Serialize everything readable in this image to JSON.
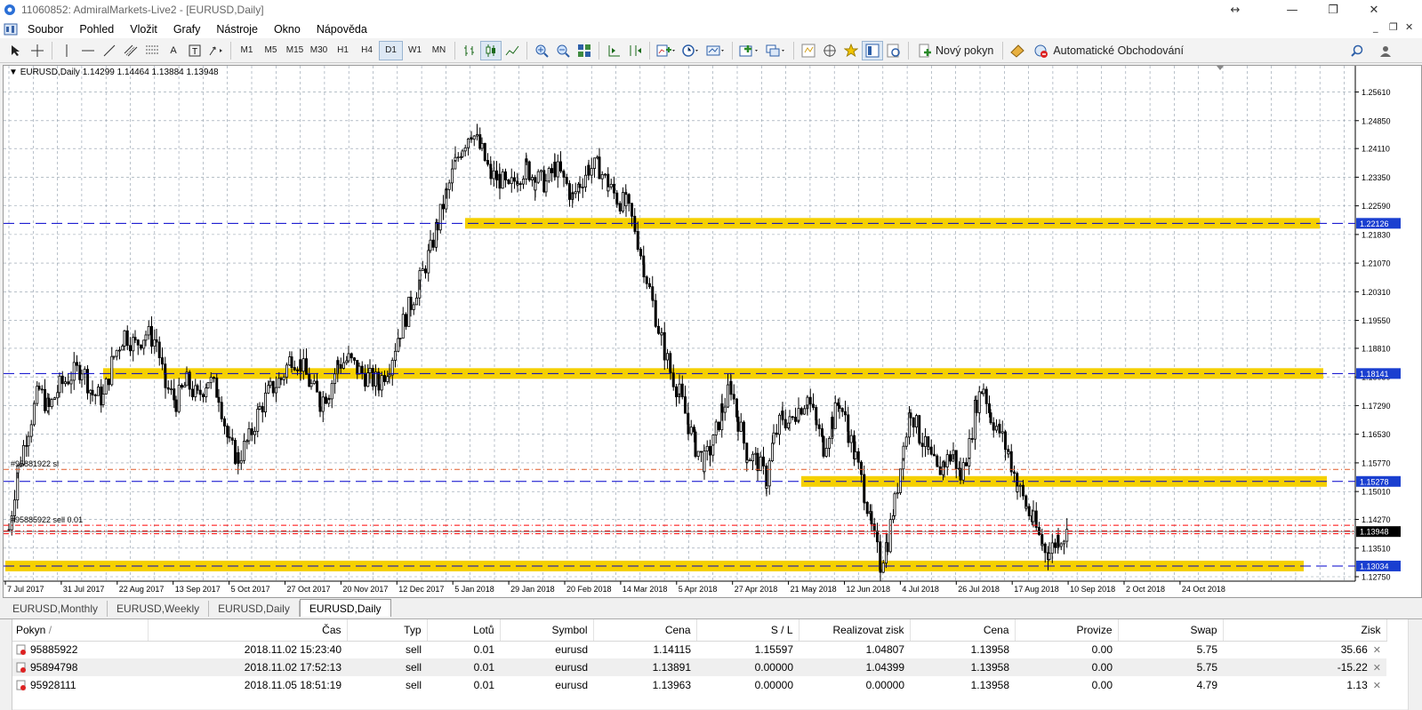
{
  "window": {
    "title": "11060852: AdmiralMarkets-Live2 - [EURUSD,Daily]"
  },
  "menu": [
    "Soubor",
    "Pohled",
    "Vložit",
    "Grafy",
    "Nástroje",
    "Okno",
    "Nápověda"
  ],
  "toolbar": {
    "timeframes": [
      "M1",
      "M5",
      "M15",
      "M30",
      "H1",
      "H4",
      "D1",
      "W1",
      "MN"
    ],
    "active_timeframe": "D1",
    "new_order_label": "Nový pokyn",
    "auto_trading_label": "Automatické Obchodování"
  },
  "chart_data": {
    "type": "candlestick",
    "symbol_header": "EURUSD,Daily  1.14299 1.14464 1.13884 1.13948",
    "price_axis": {
      "min": 1.1275,
      "max": 1.26,
      "ticks": [
        "1.25610",
        "1.24850",
        "1.24110",
        "1.23350",
        "1.22590",
        "1.21830",
        "1.21070",
        "1.20310",
        "1.19550",
        "1.18810",
        "1.18050",
        "1.17290",
        "1.16530",
        "1.15770",
        "1.15010",
        "1.14270",
        "1.13510",
        "1.12750"
      ]
    },
    "time_labels": [
      "7 Jul 2017",
      "31 Jul 2017",
      "22 Aug 2017",
      "13 Sep 2017",
      "5 Oct 2017",
      "27 Oct 2017",
      "20 Nov 2017",
      "12 Dec 2017",
      "5 Jan 2018",
      "29 Jan 2018",
      "20 Feb 2018",
      "14 Mar 2018",
      "5 Apr 2018",
      "27 Apr 2018",
      "21 May 2018",
      "12 Jun 2018",
      "4 Jul 2018",
      "26 Jul 2018",
      "17 Aug 2018",
      "10 Sep 2018",
      "2 Oct 2018",
      "24 Oct 2018"
    ],
    "close_path": [
      [
        0,
        1.14
      ],
      [
        10,
        1.156
      ],
      [
        22,
        1.167
      ],
      [
        34,
        1.177
      ],
      [
        45,
        1.172
      ],
      [
        57,
        1.178
      ],
      [
        70,
        1.181
      ],
      [
        82,
        1.183
      ],
      [
        94,
        1.176
      ],
      [
        106,
        1.175
      ],
      [
        118,
        1.186
      ],
      [
        130,
        1.192
      ],
      [
        142,
        1.189
      ],
      [
        154,
        1.192
      ],
      [
        166,
        1.19
      ],
      [
        176,
        1.178
      ],
      [
        188,
        1.174
      ],
      [
        200,
        1.179
      ],
      [
        212,
        1.175
      ],
      [
        224,
        1.18
      ],
      [
        236,
        1.176
      ],
      [
        248,
        1.162
      ],
      [
        258,
        1.159
      ],
      [
        270,
        1.164
      ],
      [
        282,
        1.172
      ],
      [
        294,
        1.177
      ],
      [
        306,
        1.18
      ],
      [
        318,
        1.186
      ],
      [
        328,
        1.184
      ],
      [
        340,
        1.178
      ],
      [
        350,
        1.174
      ],
      [
        360,
        1.177
      ],
      [
        370,
        1.184
      ],
      [
        382,
        1.185
      ],
      [
        394,
        1.182
      ],
      [
        406,
        1.18
      ],
      [
        416,
        1.179
      ],
      [
        428,
        1.184
      ],
      [
        440,
        1.193
      ],
      [
        452,
        1.2
      ],
      [
        462,
        1.206
      ],
      [
        474,
        1.214
      ],
      [
        482,
        1.221
      ],
      [
        492,
        1.229
      ],
      [
        502,
        1.237
      ],
      [
        510,
        1.242
      ],
      [
        520,
        1.246
      ],
      [
        532,
        1.24
      ],
      [
        542,
        1.234
      ],
      [
        552,
        1.233
      ],
      [
        562,
        1.23
      ],
      [
        572,
        1.234
      ],
      [
        582,
        1.236
      ],
      [
        592,
        1.233
      ],
      [
        604,
        1.232
      ],
      [
        614,
        1.236
      ],
      [
        624,
        1.233
      ],
      [
        634,
        1.228
      ],
      [
        642,
        1.232
      ],
      [
        652,
        1.236
      ],
      [
        664,
        1.236
      ],
      [
        674,
        1.231
      ],
      [
        684,
        1.228
      ],
      [
        694,
        1.226
      ],
      [
        704,
        1.22
      ],
      [
        714,
        1.21
      ],
      [
        724,
        1.2
      ],
      [
        734,
        1.19
      ],
      [
        744,
        1.182
      ],
      [
        754,
        1.176
      ],
      [
        764,
        1.168
      ],
      [
        772,
        1.162
      ],
      [
        782,
        1.158
      ],
      [
        792,
        1.163
      ],
      [
        802,
        1.172
      ],
      [
        812,
        1.178
      ],
      [
        820,
        1.169
      ],
      [
        830,
        1.16
      ],
      [
        842,
        1.158
      ],
      [
        852,
        1.153
      ],
      [
        860,
        1.164
      ],
      [
        870,
        1.17
      ],
      [
        878,
        1.168
      ],
      [
        888,
        1.172
      ],
      [
        898,
        1.175
      ],
      [
        908,
        1.168
      ],
      [
        916,
        1.162
      ],
      [
        926,
        1.169
      ],
      [
        934,
        1.174
      ],
      [
        944,
        1.166
      ],
      [
        952,
        1.159
      ],
      [
        962,
        1.15
      ],
      [
        970,
        1.14
      ],
      [
        980,
        1.131
      ],
      [
        988,
        1.137
      ],
      [
        996,
        1.147
      ],
      [
        1006,
        1.162
      ],
      [
        1014,
        1.172
      ],
      [
        1024,
        1.165
      ],
      [
        1034,
        1.16
      ],
      [
        1044,
        1.155
      ],
      [
        1052,
        1.158
      ],
      [
        1062,
        1.16
      ],
      [
        1070,
        1.154
      ],
      [
        1080,
        1.162
      ],
      [
        1088,
        1.174
      ],
      [
        1096,
        1.178
      ],
      [
        1104,
        1.17
      ],
      [
        1114,
        1.166
      ],
      [
        1124,
        1.16
      ],
      [
        1134,
        1.152
      ],
      [
        1144,
        1.146
      ],
      [
        1152,
        1.142
      ],
      [
        1162,
        1.136
      ],
      [
        1170,
        1.134
      ],
      [
        1180,
        1.138
      ],
      [
        1192,
        1.139
      ]
    ]
  },
  "levels": [
    {
      "price": "1.22126",
      "color": "#0000ff"
    },
    {
      "price": "1.18141",
      "color": "#0000ff"
    },
    {
      "price": "1.15278",
      "color": "#0000ff"
    },
    {
      "price": "1.13034",
      "color": "#0000ff"
    },
    {
      "price": "1.13948",
      "color": "#000000"
    }
  ],
  "chart_overlays": {
    "sl_label": "#95881922 sl",
    "order_label": "#95885922 sell 0.01"
  },
  "colors": {
    "support_zone": "#f5d000",
    "level_line": "#0000cc",
    "sl_line": "#e05a2a",
    "order_line": "#ff0000"
  },
  "chart_tabs": [
    "EURUSD,Monthly",
    "EURUSD,Weekly",
    "EURUSD,Daily",
    "EURUSD,Daily"
  ],
  "active_chart_tab": 3,
  "orders": {
    "columns": [
      "Pokyn",
      "Čas",
      "Typ",
      "Lotů",
      "Symbol",
      "Cena",
      "S / L",
      "Realizovat zisk",
      "Cena",
      "Provize",
      "Swap",
      "Zisk"
    ],
    "rows": [
      [
        "95885922",
        "2018.11.02 15:23:40",
        "sell",
        "0.01",
        "eurusd",
        "1.14115",
        "1.15597",
        "1.04807",
        "1.13958",
        "0.00",
        "5.75",
        "35.66"
      ],
      [
        "95894798",
        "2018.11.02 17:52:13",
        "sell",
        "0.01",
        "eurusd",
        "1.13891",
        "0.00000",
        "1.04399",
        "1.13958",
        "0.00",
        "5.75",
        "-15.22"
      ],
      [
        "95928111",
        "2018.11.05 18:51:19",
        "sell",
        "0.01",
        "eurusd",
        "1.13963",
        "0.00000",
        "0.00000",
        "1.13958",
        "0.00",
        "4.79",
        "1.13"
      ]
    ]
  }
}
